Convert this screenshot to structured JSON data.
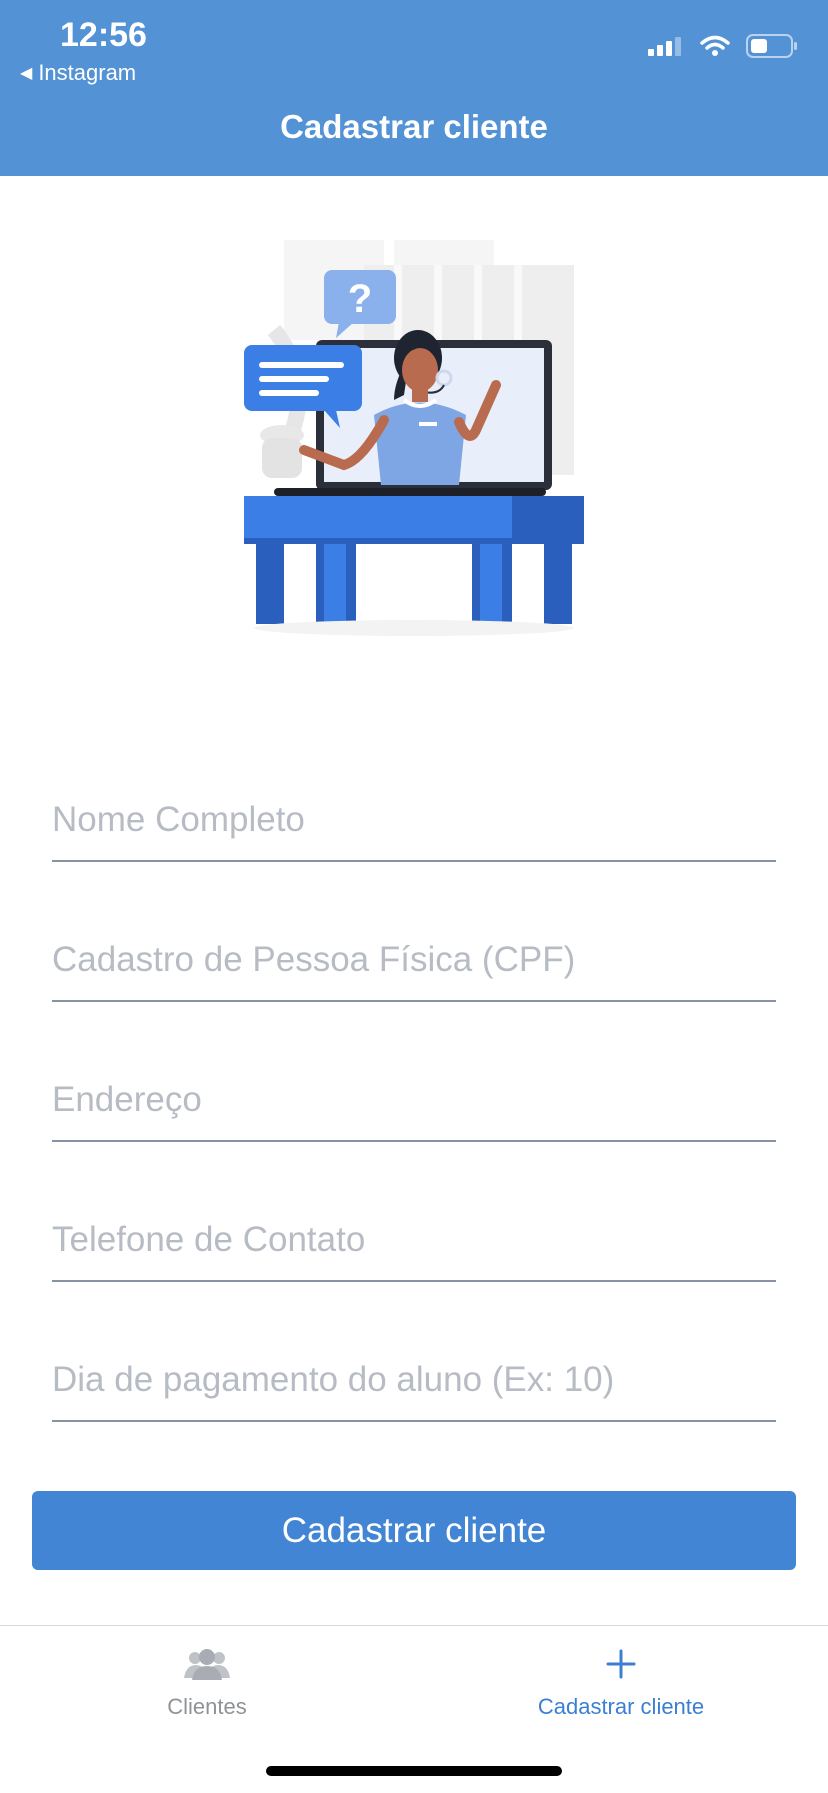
{
  "status_bar": {
    "time": "12:56",
    "back_app": "Instagram"
  },
  "header": {
    "title": "Cadastrar cliente"
  },
  "illustration": {
    "bubble_symbol": "?"
  },
  "form": {
    "fields": [
      {
        "placeholder": "Nome Completo",
        "value": ""
      },
      {
        "placeholder": "Cadastro de Pessoa Física (CPF)",
        "value": ""
      },
      {
        "placeholder": "Endereço",
        "value": ""
      },
      {
        "placeholder": "Telefone de Contato",
        "value": ""
      },
      {
        "placeholder": "Dia de pagamento do aluno (Ex: 10)",
        "value": ""
      }
    ],
    "submit_label": "Cadastrar cliente"
  },
  "tabbar": {
    "tabs": [
      {
        "label": "Clientes",
        "icon": "users-icon",
        "active": false
      },
      {
        "label": "Cadastrar cliente",
        "icon": "plus-icon",
        "active": true
      }
    ]
  },
  "colors": {
    "header": "#5292d5",
    "button": "#4285d5",
    "active_tab": "#3c7fd2",
    "inactive_tab": "#8f9398",
    "underline": "#8793a5"
  }
}
